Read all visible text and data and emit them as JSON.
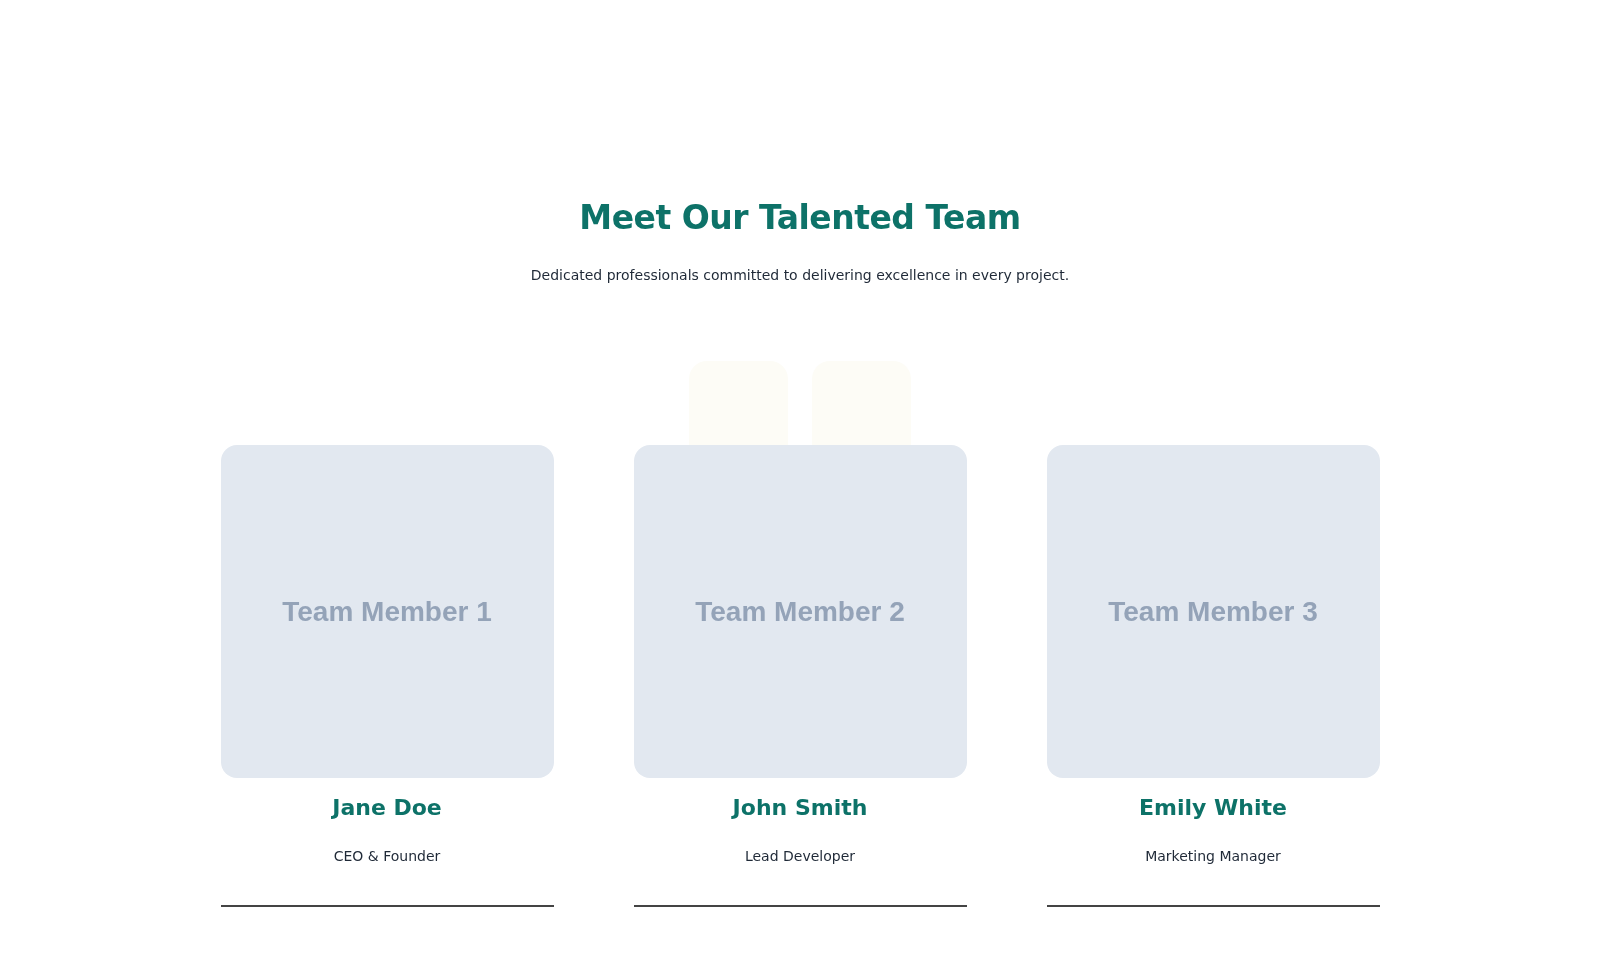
{
  "heading": "Meet Our Talented Team",
  "subheading": "Dedicated professionals committed to delivering excellence in every project.",
  "members": [
    {
      "placeholder": "Team Member 1",
      "name": "Jane Doe",
      "role": "CEO & Founder"
    },
    {
      "placeholder": "Team Member 2",
      "name": "John Smith",
      "role": "Lead Developer"
    },
    {
      "placeholder": "Team Member 3",
      "name": "Emily White",
      "role": "Marketing Manager"
    }
  ]
}
